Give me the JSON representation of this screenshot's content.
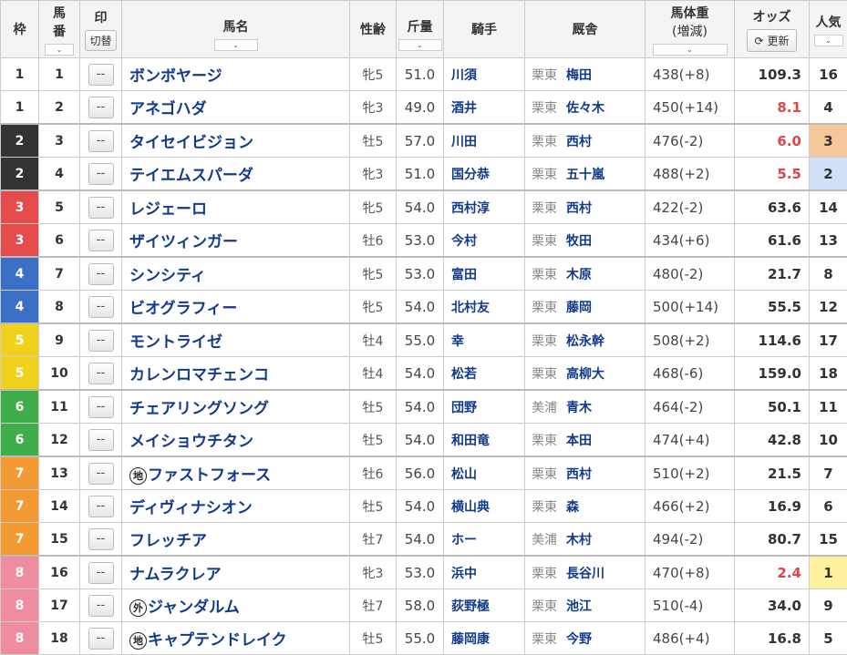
{
  "header": {
    "waku": "枠",
    "umaban": "馬\n番",
    "umaban_l1": "馬",
    "umaban_l2": "番",
    "mark": "印",
    "mark_switch": "切替",
    "name": "馬名",
    "sex_age": "性齢",
    "weight": "斤量",
    "jockey": "騎手",
    "stable": "厩舎",
    "body_l1": "馬体重",
    "body_l2": "(増減)",
    "odds": "オッズ",
    "refresh": "更新",
    "pop": "人気",
    "sort_glyph": "⌄"
  },
  "mark_placeholder": "--",
  "frame_colors": {
    "1": {
      "bg": "#ffffff",
      "fg": "#333333"
    },
    "2": {
      "bg": "#333333",
      "fg": "#ffffff"
    },
    "3": {
      "bg": "#e64b4b",
      "fg": "#ffffff"
    },
    "4": {
      "bg": "#3c6fc6",
      "fg": "#ffffff"
    },
    "5": {
      "bg": "#f0d21c",
      "fg": "#ffffff"
    },
    "6": {
      "bg": "#3fae4a",
      "fg": "#ffffff"
    },
    "7": {
      "bg": "#f49a32",
      "fg": "#ffffff"
    },
    "8": {
      "bg": "#f08ca0",
      "fg": "#ffffff"
    }
  },
  "rows": [
    {
      "waku": "1",
      "umaban": "1",
      "tag": "",
      "name": "ボンボヤージ",
      "sex_age": "牝5",
      "weight": "51.0",
      "jockey": "川須",
      "region": "栗東",
      "trainer": "梅田",
      "body": "438(+8)",
      "odds": "109.3",
      "odds_hot": false,
      "pop": "16",
      "pop_rank": 0
    },
    {
      "waku": "1",
      "umaban": "2",
      "tag": "",
      "name": "アネゴハダ",
      "sex_age": "牝3",
      "weight": "49.0",
      "jockey": "酒井",
      "region": "栗東",
      "trainer": "佐々木",
      "body": "450(+14)",
      "odds": "8.1",
      "odds_hot": true,
      "pop": "4",
      "pop_rank": 0
    },
    {
      "waku": "2",
      "umaban": "3",
      "tag": "",
      "name": "タイセイビジョン",
      "sex_age": "牡5",
      "weight": "57.0",
      "jockey": "川田",
      "region": "栗東",
      "trainer": "西村",
      "body": "476(-2)",
      "odds": "6.0",
      "odds_hot": true,
      "pop": "3",
      "pop_rank": 3
    },
    {
      "waku": "2",
      "umaban": "4",
      "tag": "",
      "name": "テイエムスパーダ",
      "sex_age": "牝3",
      "weight": "51.0",
      "jockey": "国分恭",
      "region": "栗東",
      "trainer": "五十嵐",
      "body": "488(+2)",
      "odds": "5.5",
      "odds_hot": true,
      "pop": "2",
      "pop_rank": 2
    },
    {
      "waku": "3",
      "umaban": "5",
      "tag": "",
      "name": "レジェーロ",
      "sex_age": "牝5",
      "weight": "54.0",
      "jockey": "西村淳",
      "region": "栗東",
      "trainer": "西村",
      "body": "422(-2)",
      "odds": "63.6",
      "odds_hot": false,
      "pop": "14",
      "pop_rank": 0
    },
    {
      "waku": "3",
      "umaban": "6",
      "tag": "",
      "name": "ザイツィンガー",
      "sex_age": "牡6",
      "weight": "53.0",
      "jockey": "今村",
      "region": "栗東",
      "trainer": "牧田",
      "body": "434(+6)",
      "odds": "61.6",
      "odds_hot": false,
      "pop": "13",
      "pop_rank": 0
    },
    {
      "waku": "4",
      "umaban": "7",
      "tag": "",
      "name": "シンシティ",
      "sex_age": "牝5",
      "weight": "53.0",
      "jockey": "富田",
      "region": "栗東",
      "trainer": "木原",
      "body": "480(-2)",
      "odds": "21.7",
      "odds_hot": false,
      "pop": "8",
      "pop_rank": 0
    },
    {
      "waku": "4",
      "umaban": "8",
      "tag": "",
      "name": "ビオグラフィー",
      "sex_age": "牝5",
      "weight": "54.0",
      "jockey": "北村友",
      "region": "栗東",
      "trainer": "藤岡",
      "body": "500(+14)",
      "odds": "55.5",
      "odds_hot": false,
      "pop": "12",
      "pop_rank": 0
    },
    {
      "waku": "5",
      "umaban": "9",
      "tag": "",
      "name": "モントライゼ",
      "sex_age": "牡4",
      "weight": "55.0",
      "jockey": "幸",
      "region": "栗東",
      "trainer": "松永幹",
      "body": "508(+2)",
      "odds": "114.6",
      "odds_hot": false,
      "pop": "17",
      "pop_rank": 0
    },
    {
      "waku": "5",
      "umaban": "10",
      "tag": "",
      "name": "カレンロマチェンコ",
      "sex_age": "牡4",
      "weight": "54.0",
      "jockey": "松若",
      "region": "栗東",
      "trainer": "高柳大",
      "body": "468(-6)",
      "odds": "159.0",
      "odds_hot": false,
      "pop": "18",
      "pop_rank": 0
    },
    {
      "waku": "6",
      "umaban": "11",
      "tag": "",
      "name": "チェアリングソング",
      "sex_age": "牡5",
      "weight": "54.0",
      "jockey": "団野",
      "region": "美浦",
      "trainer": "青木",
      "body": "464(-2)",
      "odds": "50.1",
      "odds_hot": false,
      "pop": "11",
      "pop_rank": 0
    },
    {
      "waku": "6",
      "umaban": "12",
      "tag": "",
      "name": "メイショウチタン",
      "sex_age": "牡5",
      "weight": "54.0",
      "jockey": "和田竜",
      "region": "栗東",
      "trainer": "本田",
      "body": "474(+4)",
      "odds": "42.8",
      "odds_hot": false,
      "pop": "10",
      "pop_rank": 0
    },
    {
      "waku": "7",
      "umaban": "13",
      "tag": "地",
      "name": "ファストフォース",
      "sex_age": "牡6",
      "weight": "56.0",
      "jockey": "松山",
      "region": "栗東",
      "trainer": "西村",
      "body": "510(+2)",
      "odds": "21.5",
      "odds_hot": false,
      "pop": "7",
      "pop_rank": 0
    },
    {
      "waku": "7",
      "umaban": "14",
      "tag": "",
      "name": "ディヴィナシオン",
      "sex_age": "牡5",
      "weight": "54.0",
      "jockey": "横山典",
      "region": "栗東",
      "trainer": "森",
      "body": "466(+2)",
      "odds": "16.9",
      "odds_hot": false,
      "pop": "6",
      "pop_rank": 0
    },
    {
      "waku": "7",
      "umaban": "15",
      "tag": "",
      "name": "フレッチア",
      "sex_age": "牡7",
      "weight": "54.0",
      "jockey": "ホー",
      "region": "美浦",
      "trainer": "木村",
      "body": "494(-2)",
      "odds": "80.7",
      "odds_hot": false,
      "pop": "15",
      "pop_rank": 0
    },
    {
      "waku": "8",
      "umaban": "16",
      "tag": "",
      "name": "ナムラクレア",
      "sex_age": "牝3",
      "weight": "53.0",
      "jockey": "浜中",
      "region": "栗東",
      "trainer": "長谷川",
      "body": "470(+8)",
      "odds": "2.4",
      "odds_hot": true,
      "pop": "1",
      "pop_rank": 1
    },
    {
      "waku": "8",
      "umaban": "17",
      "tag": "外",
      "name": "ジャンダルム",
      "sex_age": "牡7",
      "weight": "58.0",
      "jockey": "荻野極",
      "region": "栗東",
      "trainer": "池江",
      "body": "510(-4)",
      "odds": "34.0",
      "odds_hot": false,
      "pop": "9",
      "pop_rank": 0
    },
    {
      "waku": "8",
      "umaban": "18",
      "tag": "地",
      "name": "キャプテンドレイク",
      "sex_age": "牡5",
      "weight": "55.0",
      "jockey": "藤岡康",
      "region": "栗東",
      "trainer": "今野",
      "body": "486(+4)",
      "odds": "16.8",
      "odds_hot": false,
      "pop": "5",
      "pop_rank": 0
    }
  ]
}
